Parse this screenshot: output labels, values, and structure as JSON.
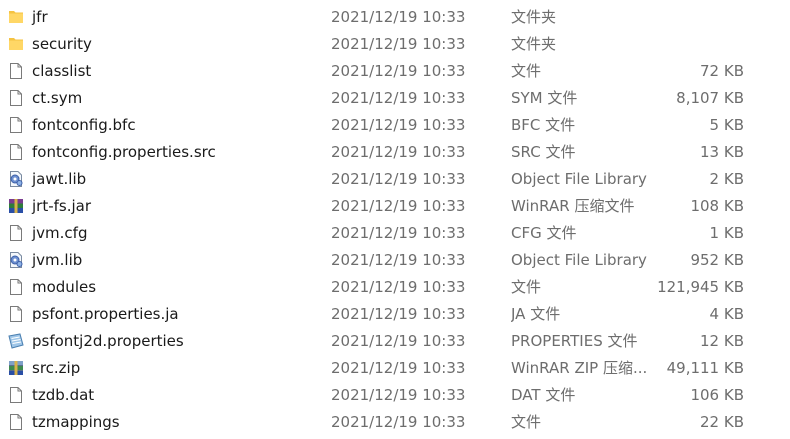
{
  "files": [
    {
      "name": "jfr",
      "date": "2021/12/19 10:33",
      "type": "文件夹",
      "size": "",
      "icon": "folder-icon"
    },
    {
      "name": "security",
      "date": "2021/12/19 10:33",
      "type": "文件夹",
      "size": "",
      "icon": "folder-icon"
    },
    {
      "name": "classlist",
      "date": "2021/12/19 10:33",
      "type": "文件",
      "size": "72 KB",
      "icon": "file-icon"
    },
    {
      "name": "ct.sym",
      "date": "2021/12/19 10:33",
      "type": "SYM 文件",
      "size": "8,107 KB",
      "icon": "file-icon"
    },
    {
      "name": "fontconfig.bfc",
      "date": "2021/12/19 10:33",
      "type": "BFC 文件",
      "size": "5 KB",
      "icon": "file-icon"
    },
    {
      "name": "fontconfig.properties.src",
      "date": "2021/12/19 10:33",
      "type": "SRC 文件",
      "size": "13 KB",
      "icon": "file-icon"
    },
    {
      "name": "jawt.lib",
      "date": "2021/12/19 10:33",
      "type": "Object File Library",
      "size": "2 KB",
      "icon": "library-icon"
    },
    {
      "name": "jrt-fs.jar",
      "date": "2021/12/19 10:33",
      "type": "WinRAR 压缩文件",
      "size": "108 KB",
      "icon": "winrar-archive-icon"
    },
    {
      "name": "jvm.cfg",
      "date": "2021/12/19 10:33",
      "type": "CFG 文件",
      "size": "1 KB",
      "icon": "file-icon"
    },
    {
      "name": "jvm.lib",
      "date": "2021/12/19 10:33",
      "type": "Object File Library",
      "size": "952 KB",
      "icon": "library-icon"
    },
    {
      "name": "modules",
      "date": "2021/12/19 10:33",
      "type": "文件",
      "size": "121,945 KB",
      "icon": "file-icon"
    },
    {
      "name": "psfont.properties.ja",
      "date": "2021/12/19 10:33",
      "type": "JA 文件",
      "size": "4 KB",
      "icon": "file-icon"
    },
    {
      "name": "psfontj2d.properties",
      "date": "2021/12/19 10:33",
      "type": "PROPERTIES 文件",
      "size": "12 KB",
      "icon": "properties-file-icon"
    },
    {
      "name": "src.zip",
      "date": "2021/12/19 10:33",
      "type": "WinRAR ZIP 压缩...",
      "size": "49,111 KB",
      "icon": "winrar-zip-icon"
    },
    {
      "name": "tzdb.dat",
      "date": "2021/12/19 10:33",
      "type": "DAT 文件",
      "size": "106 KB",
      "icon": "file-icon"
    },
    {
      "name": "tzmappings",
      "date": "2021/12/19 10:33",
      "type": "文件",
      "size": "22 KB",
      "icon": "file-icon"
    }
  ],
  "colors": {
    "folder": "#f5c342",
    "text": "#1a1a1a",
    "muted": "#6d6d6d"
  }
}
